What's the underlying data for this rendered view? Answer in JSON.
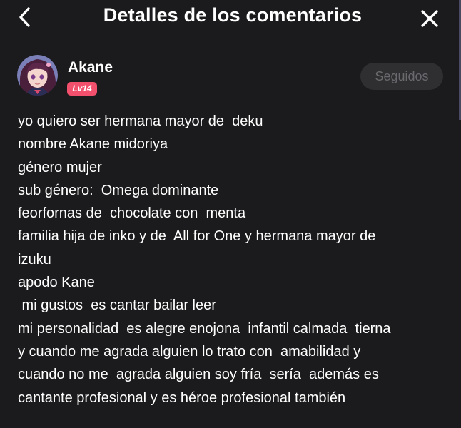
{
  "header": {
    "title": "Detalles de los comentarios",
    "back_icon": "chevron-left-icon",
    "close_icon": "close-icon"
  },
  "comment": {
    "author": {
      "name": "Akane",
      "level": "Lv14",
      "avatar": "avatar-anime-girl"
    },
    "follow_label": "Seguidos",
    "lines": [
      "yo quiero ser hermana mayor de  deku",
      "nombre Akane midoriya",
      "género mujer",
      "sub género:  Omega dominante",
      "feorfornas de  chocolate con  menta",
      "familia hija de inko y de  All for One y hermana mayor de",
      "izuku",
      "apodo Kane",
      " mi gustos  es cantar bailar leer",
      "mi personalidad  es alegre enojona  infantil calmada  tierna",
      "y cuando me agrada alguien lo trato con  amabilidad y",
      "cuando no me  agrada alguien soy fría  sería  además es",
      "cantante profesional y es héroe profesional también"
    ]
  },
  "colors": {
    "background": "#1b1b1d",
    "level_badge": "#f3506d",
    "follow_button": "#2f2f32",
    "follow_text": "#6a6a6e"
  }
}
